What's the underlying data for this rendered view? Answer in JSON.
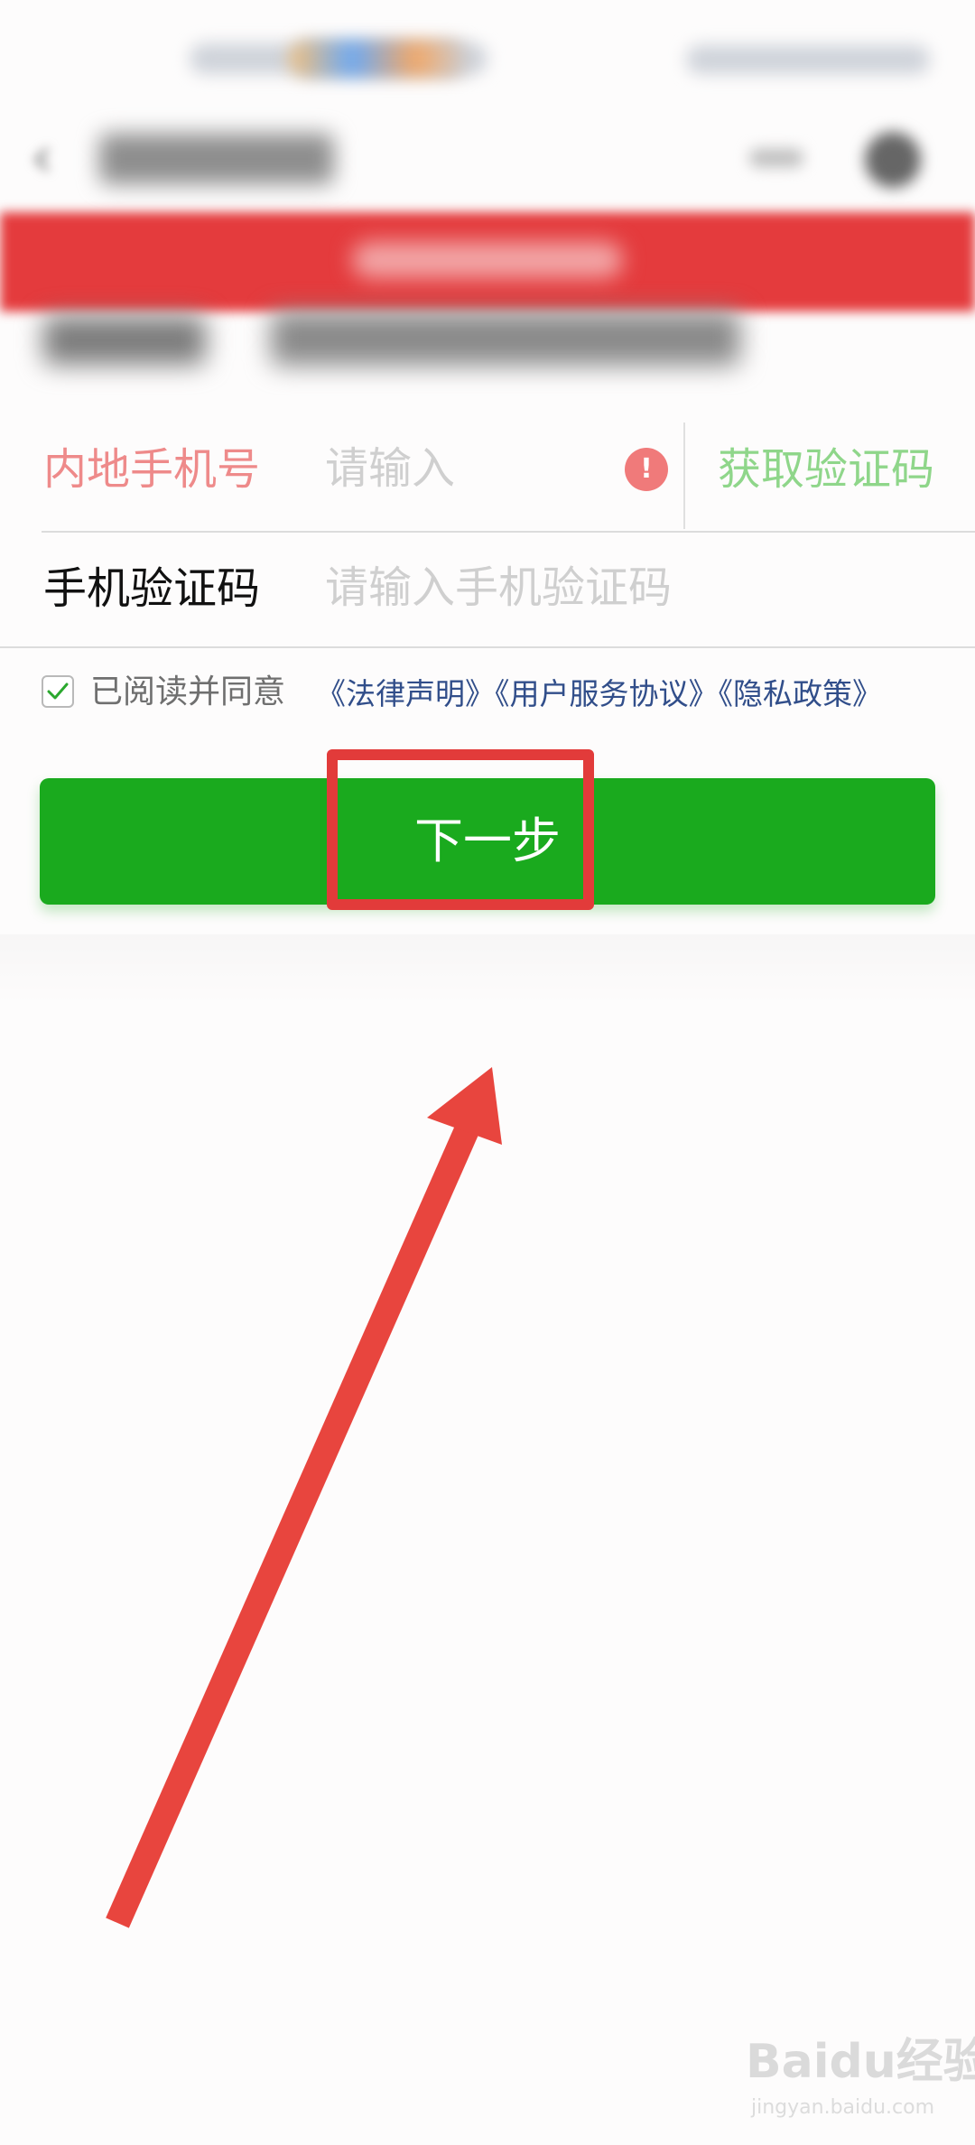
{
  "form": {
    "phone_label": "内地手机号",
    "phone_placeholder": "请输入",
    "get_code_label": "获取验证码",
    "code_label": "手机验证码",
    "code_placeholder": "请输入手机验证码"
  },
  "agreement": {
    "checked": true,
    "prefix": "已阅读并同意",
    "links": [
      "《法律声明》",
      "《用户服务协议》",
      "《隐私政策》"
    ]
  },
  "next_button": {
    "label": "下一步"
  },
  "watermark": {
    "logo": "Baidu经验",
    "url": "jingyan.baidu.com"
  },
  "colors": {
    "accent_green": "#1aaa1e",
    "warning_red": "#e43b3d",
    "link_blue": "#314e8a",
    "annotation_red": "#e23b3a"
  }
}
